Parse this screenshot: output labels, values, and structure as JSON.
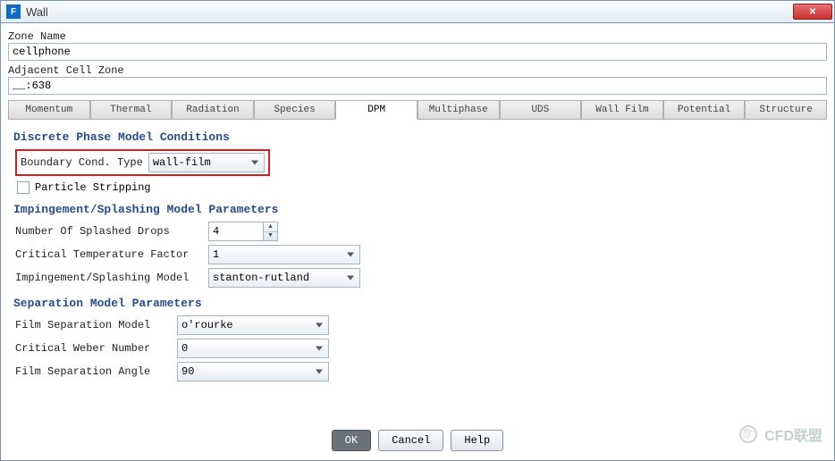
{
  "window": {
    "title": "Wall",
    "app_icon_letter": "F"
  },
  "zone": {
    "name_label": "Zone Name",
    "name_value": "cellphone",
    "adj_label": "Adjacent Cell Zone",
    "adj_value": "__:638"
  },
  "tabs": [
    "Momentum",
    "Thermal",
    "Radiation",
    "Species",
    "DPM",
    "Multiphase",
    "UDS",
    "Wall Film",
    "Potential",
    "Structure"
  ],
  "active_tab_index": 4,
  "dpm": {
    "section_title": "Discrete Phase Model Conditions",
    "bc_type_label": "Boundary Cond. Type",
    "bc_type_value": "wall-film",
    "particle_stripping_label": "Particle Stripping"
  },
  "impinge": {
    "section_title": "Impingement/Splashing Model Parameters",
    "num_drops_label": "Number Of Splashed Drops",
    "num_drops_value": "4",
    "crit_temp_label": "Critical Temperature Factor",
    "crit_temp_value": "1",
    "model_label": "Impingement/Splashing Model",
    "model_value": "stanton-rutland"
  },
  "separation": {
    "section_title": "Separation Model Parameters",
    "model_label": "Film Separation Model",
    "model_value": "o'rourke",
    "weber_label": "Critical Weber Number",
    "weber_value": "0",
    "angle_label": "Film Separation Angle",
    "angle_value": "90"
  },
  "buttons": {
    "ok": "OK",
    "cancel": "Cancel",
    "help": "Help"
  },
  "watermark": "CFD联盟"
}
